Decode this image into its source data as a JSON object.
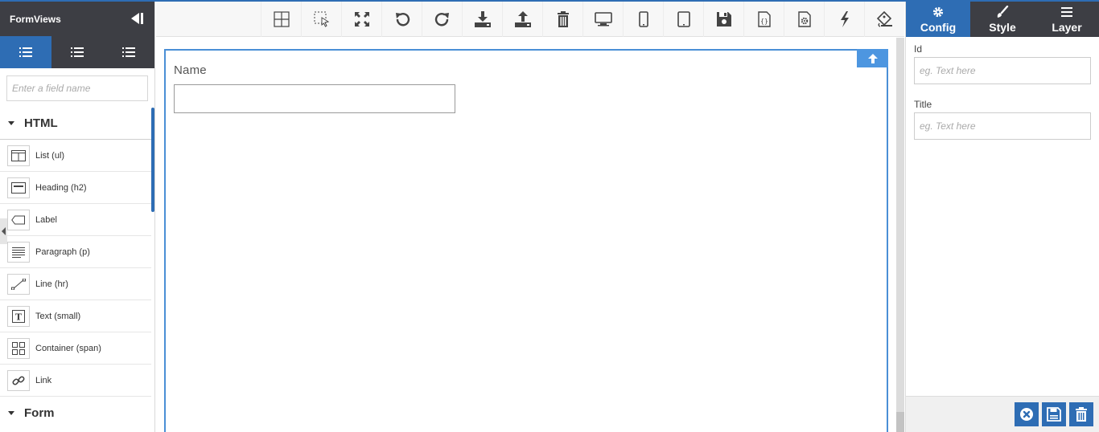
{
  "app": {
    "title": "FormViews"
  },
  "sidebar": {
    "search_placeholder": "Enter a field name",
    "tabs": [
      "list-icon",
      "list-icon",
      "list-icon"
    ],
    "categories": [
      {
        "label": "HTML",
        "items": [
          {
            "label": "List (ul)",
            "icon": "list-layout-icon"
          },
          {
            "label": "Heading (h2)",
            "icon": "heading-icon"
          },
          {
            "label": "Label",
            "icon": "tag-icon"
          },
          {
            "label": "Paragraph (p)",
            "icon": "paragraph-icon"
          },
          {
            "label": "Line (hr)",
            "icon": "line-icon"
          },
          {
            "label": "Text (small)",
            "icon": "text-icon"
          },
          {
            "label": "Container (span)",
            "icon": "container-icon"
          },
          {
            "label": "Link",
            "icon": "link-icon"
          }
        ]
      },
      {
        "label": "Form"
      }
    ]
  },
  "toolbar": {
    "buttons": [
      "grid-icon",
      "select-icon",
      "fullscreen-icon",
      "undo-icon",
      "redo-icon",
      "import-icon",
      "export-icon",
      "trash-icon",
      "desktop-icon",
      "mobile-icon",
      "tablet-icon",
      "save-icon",
      "code-icon",
      "settings-file-icon",
      "lightning-icon",
      "paint-icon"
    ]
  },
  "canvas": {
    "field_label": "Name",
    "field_value": ""
  },
  "right_panel": {
    "tabs": [
      {
        "label": "Config",
        "icon": "gear-icon"
      },
      {
        "label": "Style",
        "icon": "brush-icon"
      },
      {
        "label": "Layer",
        "icon": "menu-icon"
      }
    ],
    "fields": [
      {
        "label": "Id",
        "placeholder": "eg. Text here"
      },
      {
        "label": "Title",
        "placeholder": "eg. Text here"
      }
    ]
  },
  "colors": {
    "accent": "#2e6db4",
    "dark": "#3d3e44",
    "frame": "#4a8fd6"
  }
}
